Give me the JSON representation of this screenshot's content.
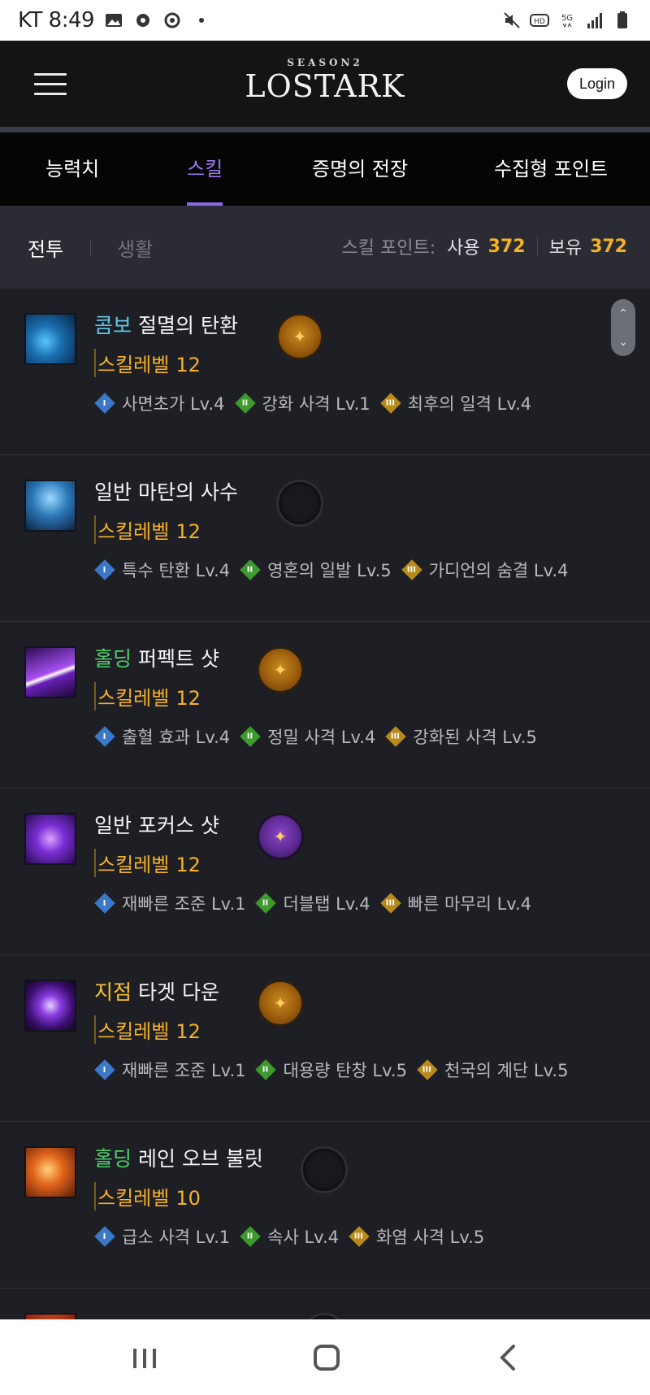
{
  "status_bar": {
    "carrier_time": "KT 8:49"
  },
  "header": {
    "logo_season": "SEASON2",
    "logo_name": "LOSTARK",
    "login_label": "Login"
  },
  "tabs": [
    {
      "label": "능력치",
      "active": false
    },
    {
      "label": "스킬",
      "active": true
    },
    {
      "label": "증명의 전장",
      "active": false
    },
    {
      "label": "수집형 포인트",
      "active": false
    }
  ],
  "sub_tabs": {
    "combat": "전투",
    "life": "생활"
  },
  "skill_points": {
    "label": "스킬 포인트:",
    "used_label": "사용",
    "used": "372",
    "owned_label": "보유",
    "owned": "372"
  },
  "skills": [
    {
      "type": "콤보",
      "type_color": "#5fc9e8",
      "name": "절멸의 탄환",
      "level_label": "스킬레벨",
      "level": "12",
      "rune": "orange",
      "icon": "blue-bow",
      "tripods": [
        {
          "tier": "I",
          "label": "사면초가 Lv.4"
        },
        {
          "tier": "II",
          "label": "강화 사격 Lv.1"
        },
        {
          "tier": "III",
          "label": "최후의 일격 Lv.4"
        }
      ]
    },
    {
      "type": "일반",
      "type_color": "#f4f4f6",
      "name": "마탄의 사수",
      "level_label": "스킬레벨",
      "level": "12",
      "rune": "empty",
      "icon": "blue-archer",
      "tripods": [
        {
          "tier": "I",
          "label": "특수 탄환 Lv.4"
        },
        {
          "tier": "II",
          "label": "영혼의 일발 Lv.5"
        },
        {
          "tier": "III",
          "label": "가디언의 숨결 Lv.4"
        }
      ]
    },
    {
      "type": "홀딩",
      "type_color": "#4fcf6a",
      "name": "퍼펙트 샷",
      "level_label": "스킬레벨",
      "level": "12",
      "rune": "orange",
      "icon": "purple-beam",
      "tripods": [
        {
          "tier": "I",
          "label": "출혈 효과 Lv.4"
        },
        {
          "tier": "II",
          "label": "정밀 사격 Lv.4"
        },
        {
          "tier": "III",
          "label": "강화된 사격 Lv.5"
        }
      ]
    },
    {
      "type": "일반",
      "type_color": "#f4f4f6",
      "name": "포커스 샷",
      "level_label": "스킬레벨",
      "level": "12",
      "rune": "purple",
      "icon": "purple-swirl",
      "tripods": [
        {
          "tier": "I",
          "label": "재빠른 조준 Lv.1"
        },
        {
          "tier": "II",
          "label": "더블탭 Lv.4"
        },
        {
          "tier": "III",
          "label": "빠른 마무리 Lv.4"
        }
      ]
    },
    {
      "type": "지점",
      "type_color": "#f6c22a",
      "name": "타겟 다운",
      "level_label": "스킬레벨",
      "level": "12",
      "rune": "orange",
      "icon": "purple-target",
      "tripods": [
        {
          "tier": "I",
          "label": "재빠른 조준 Lv.1"
        },
        {
          "tier": "II",
          "label": "대용량 탄창 Lv.5"
        },
        {
          "tier": "III",
          "label": "천국의 계단 Lv.5"
        }
      ]
    },
    {
      "type": "홀딩",
      "type_color": "#4fcf6a",
      "name": "레인 오브 불릿",
      "level_label": "스킬레벨",
      "level": "10",
      "rune": "empty",
      "icon": "fire-gunner",
      "tripods": [
        {
          "tier": "I",
          "label": "급소 사격 Lv.1"
        },
        {
          "tier": "II",
          "label": "속사 Lv.4"
        },
        {
          "tier": "III",
          "label": "화염 사격 Lv.5"
        }
      ]
    }
  ]
}
